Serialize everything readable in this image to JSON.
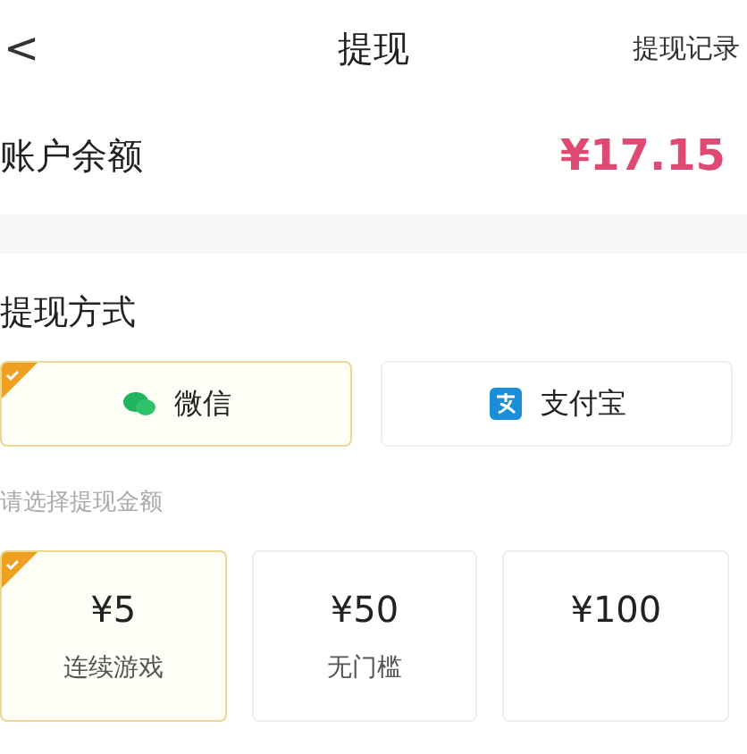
{
  "header": {
    "back": "<",
    "title": "提现",
    "action": "提现记录"
  },
  "balance": {
    "label": "账户余额",
    "amount": "¥17.15"
  },
  "method": {
    "title": "提现方式",
    "options": [
      {
        "label": "微信",
        "kind": "wechat",
        "selected": true
      },
      {
        "label": "支付宝",
        "kind": "alipay",
        "selected": false
      }
    ]
  },
  "amounts": {
    "hint": "请选择提现金额",
    "options": [
      {
        "value": "¥5",
        "note": "连续游戏",
        "selected": true
      },
      {
        "value": "¥50",
        "note": "无门槛",
        "selected": false
      },
      {
        "value": "¥100",
        "selected": false
      }
    ]
  }
}
